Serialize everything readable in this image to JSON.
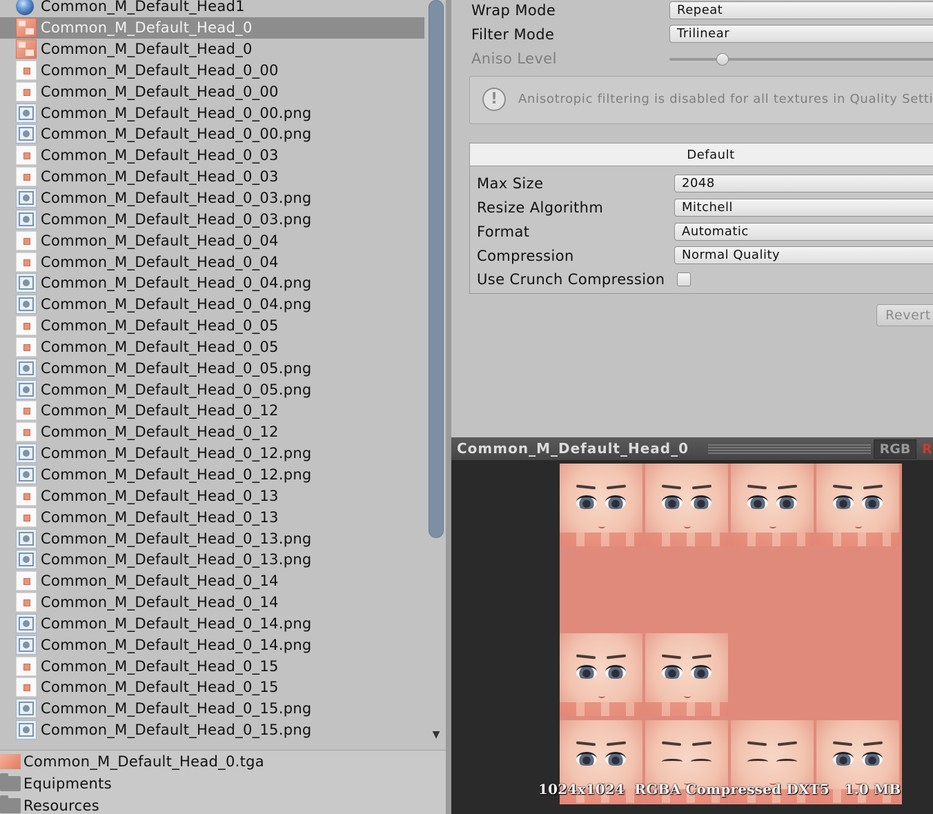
{
  "project": {
    "assets": [
      {
        "name": "Common_M_Default_Head1",
        "icon": "sphere",
        "selected": false
      },
      {
        "name": "Common_M_Default_Head_0",
        "icon": "texture",
        "selected": true
      },
      {
        "name": "Common_M_Default_Head_0",
        "icon": "texture",
        "selected": false
      },
      {
        "name": "Common_M_Default_Head_0_00",
        "icon": "sprite",
        "selected": false
      },
      {
        "name": "Common_M_Default_Head_0_00",
        "icon": "sprite",
        "selected": false
      },
      {
        "name": "Common_M_Default_Head_0_00.png",
        "icon": "image",
        "selected": false
      },
      {
        "name": "Common_M_Default_Head_0_00.png",
        "icon": "image",
        "selected": false
      },
      {
        "name": "Common_M_Default_Head_0_03",
        "icon": "sprite",
        "selected": false
      },
      {
        "name": "Common_M_Default_Head_0_03",
        "icon": "sprite",
        "selected": false
      },
      {
        "name": "Common_M_Default_Head_0_03.png",
        "icon": "image",
        "selected": false
      },
      {
        "name": "Common_M_Default_Head_0_03.png",
        "icon": "image",
        "selected": false
      },
      {
        "name": "Common_M_Default_Head_0_04",
        "icon": "sprite",
        "selected": false
      },
      {
        "name": "Common_M_Default_Head_0_04",
        "icon": "sprite",
        "selected": false
      },
      {
        "name": "Common_M_Default_Head_0_04.png",
        "icon": "image",
        "selected": false
      },
      {
        "name": "Common_M_Default_Head_0_04.png",
        "icon": "image",
        "selected": false
      },
      {
        "name": "Common_M_Default_Head_0_05",
        "icon": "sprite",
        "selected": false
      },
      {
        "name": "Common_M_Default_Head_0_05",
        "icon": "sprite",
        "selected": false
      },
      {
        "name": "Common_M_Default_Head_0_05.png",
        "icon": "image",
        "selected": false
      },
      {
        "name": "Common_M_Default_Head_0_05.png",
        "icon": "image",
        "selected": false
      },
      {
        "name": "Common_M_Default_Head_0_12",
        "icon": "sprite",
        "selected": false
      },
      {
        "name": "Common_M_Default_Head_0_12",
        "icon": "sprite",
        "selected": false
      },
      {
        "name": "Common_M_Default_Head_0_12.png",
        "icon": "image",
        "selected": false
      },
      {
        "name": "Common_M_Default_Head_0_12.png",
        "icon": "image",
        "selected": false
      },
      {
        "name": "Common_M_Default_Head_0_13",
        "icon": "sprite",
        "selected": false
      },
      {
        "name": "Common_M_Default_Head_0_13",
        "icon": "sprite",
        "selected": false
      },
      {
        "name": "Common_M_Default_Head_0_13.png",
        "icon": "image",
        "selected": false
      },
      {
        "name": "Common_M_Default_Head_0_13.png",
        "icon": "image",
        "selected": false
      },
      {
        "name": "Common_M_Default_Head_0_14",
        "icon": "sprite",
        "selected": false
      },
      {
        "name": "Common_M_Default_Head_0_14",
        "icon": "sprite",
        "selected": false
      },
      {
        "name": "Common_M_Default_Head_0_14.png",
        "icon": "image",
        "selected": false
      },
      {
        "name": "Common_M_Default_Head_0_14.png",
        "icon": "image",
        "selected": false
      },
      {
        "name": "Common_M_Default_Head_0_15",
        "icon": "sprite",
        "selected": false
      },
      {
        "name": "Common_M_Default_Head_0_15",
        "icon": "sprite",
        "selected": false
      },
      {
        "name": "Common_M_Default_Head_0_15.png",
        "icon": "image",
        "selected": false
      },
      {
        "name": "Common_M_Default_Head_0_15.png",
        "icon": "image",
        "selected": false
      }
    ],
    "folders": [
      {
        "name": "Common_M_Default_Head_0.tga",
        "icon": "tga-file"
      },
      {
        "name": "Equipments",
        "icon": "folder"
      },
      {
        "name": "Resources",
        "icon": "folder"
      }
    ]
  },
  "inspector": {
    "wrap_mode": {
      "label": "Wrap Mode",
      "value": "Repeat"
    },
    "filter_mode": {
      "label": "Filter Mode",
      "value": "Trilinear"
    },
    "aniso_level": {
      "label": "Aniso Level",
      "slider_fraction": 0.17
    },
    "help_text": "Anisotropic filtering is disabled for all textures in Quality Setti",
    "platform_tab": "Default",
    "max_size": {
      "label": "Max Size",
      "value": "2048"
    },
    "resize_algorithm": {
      "label": "Resize Algorithm",
      "value": "Mitchell"
    },
    "format": {
      "label": "Format",
      "value": "Automatic"
    },
    "compression": {
      "label": "Compression",
      "value": "Normal Quality"
    },
    "use_crunch": {
      "label": "Use Crunch Compression",
      "checked": false
    },
    "revert_label": "Revert"
  },
  "preview": {
    "title": "Common_M_Default_Head_0",
    "rgb_label": "RGB",
    "alpha_label": "R",
    "info": "1024x1024  RGBA Compressed DXT5   1.0 MB",
    "colors": {
      "alpha_accent": "#d23a2a",
      "skin": "#e08a7c"
    }
  }
}
